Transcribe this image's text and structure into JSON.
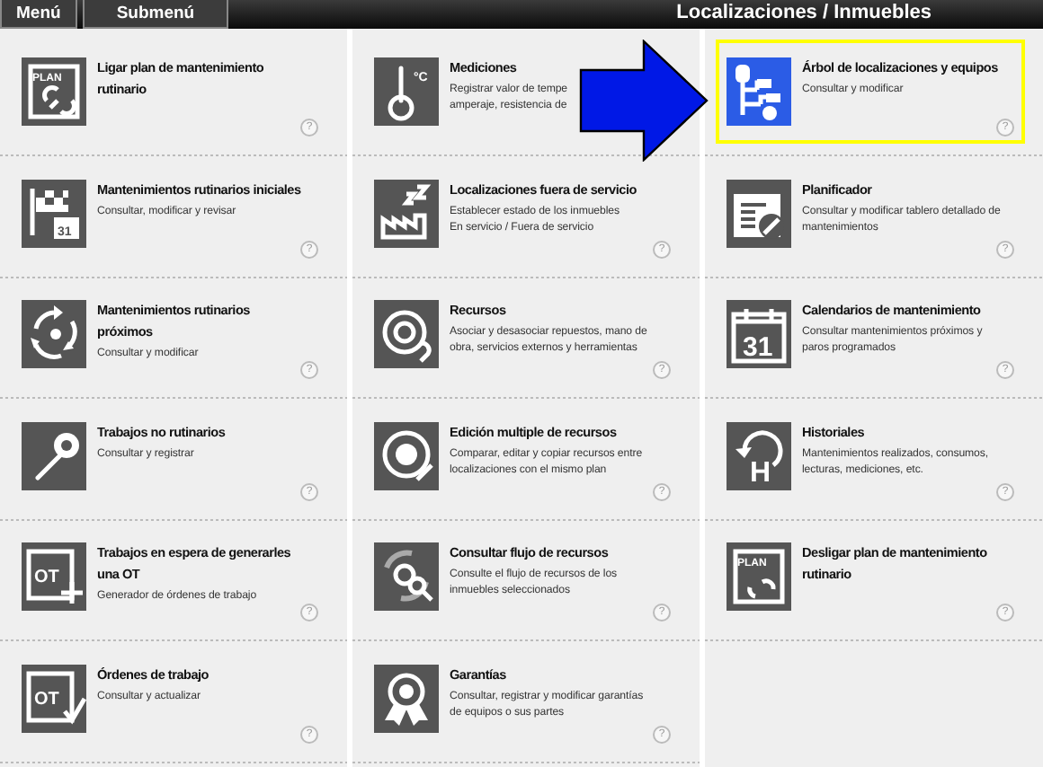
{
  "menu_bar": {
    "tabs": [
      {
        "label": "Menú",
        "selected": false
      },
      {
        "label": "Submenú",
        "selected": false
      }
    ],
    "title": "Localizaciones / Inmuebles"
  },
  "columns": [
    {
      "items": [
        {
          "title": "Ligar plan de mantenimiento rutinario",
          "icon_text": "PLAN",
          "help": "?",
          "highlighted": false
        },
        {
          "title": "Mantenimientos rutinarios iniciales",
          "description": "Consultar, modificar  y revisar",
          "icon_text": "31",
          "help": "?",
          "highlighted": false
        },
        {
          "title": "Mantenimientos rutinarios próximos",
          "description": "Consultar y modificar",
          "help": "?",
          "highlighted": false
        },
        {
          "title": "Trabajos no rutinarios",
          "description": "Consultar y registrar",
          "help": "?",
          "highlighted": false
        },
        {
          "title": "Trabajos en espera de generarles una OT",
          "description": "Generador de órdenes de trabajo",
          "icon_text": "OT",
          "help": "?",
          "highlighted": false
        },
        {
          "title": "Órdenes de trabajo",
          "description": "Consultar y actualizar",
          "icon_text": "OT",
          "help": "?",
          "highlighted": false
        }
      ]
    },
    {
      "items": [
        {
          "title": "Mediciones",
          "description": "Registrar valor de tempe\namperaje, resistencia de",
          "icon_text": "°C",
          "highlighted": false
        },
        {
          "title": "Localizaciones fuera de servicio",
          "description": "Establecer estado de los inmuebles\nEn servicio / Fuera de servicio",
          "help": "?",
          "highlighted": false
        },
        {
          "title": "Recursos",
          "description": "Asociar y desasociar repuestos, mano de\nobra, servicios externos y herramientas",
          "help": "?",
          "highlighted": false
        },
        {
          "title": "Edición multiple de recursos",
          "description": "Comparar, editar y copiar recursos entre\nlocalizaciones con el mismo  plan",
          "help": "?",
          "highlighted": false
        },
        {
          "title": "Consultar flujo de recursos",
          "description": "Consulte el flujo de recursos de los\ninmuebles seleccionados",
          "help": "?",
          "highlighted": false
        },
        {
          "title": "Garantías",
          "description": "Consultar, registrar y modificar  garantías\nde equipos o sus partes",
          "help": "?",
          "highlighted": false
        }
      ]
    },
    {
      "items": [
        {
          "title": "Árbol de localizaciones y equipos",
          "description": "Consultar y modificar",
          "help": "?",
          "highlighted": true
        },
        {
          "title": "Planificador",
          "description": "Consultar y modificar  tablero detallado de\nmantenimientos",
          "help": "?",
          "highlighted": false
        },
        {
          "title": "Calendarios de mantenimiento",
          "description": "Consultar mantenimientos  próximos y\nparos programados",
          "icon_text": "31",
          "help": "?",
          "highlighted": false
        },
        {
          "title": "Historiales",
          "description": "Mantenimientos  realizados, consumos,\nlecturas, mediciones,  etc.",
          "icon_text": "H",
          "help": "?",
          "highlighted": false
        },
        {
          "title": "Desligar plan de mantenimiento rutinario",
          "icon_text": "PLAN",
          "help": "?",
          "highlighted": false
        }
      ]
    }
  ],
  "pointer_arrow": true
}
